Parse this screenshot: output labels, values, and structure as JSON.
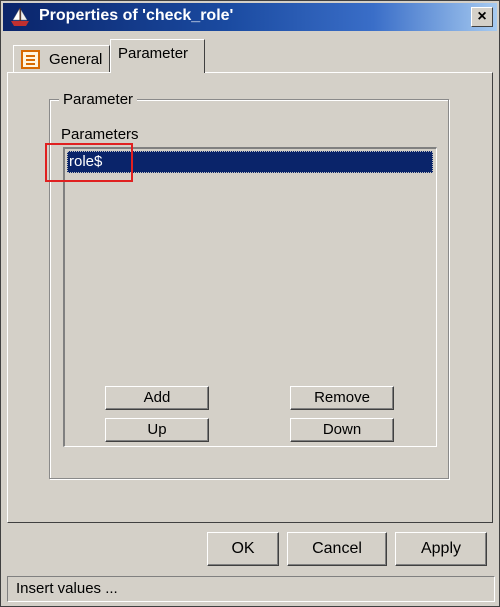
{
  "window": {
    "title": "Properties of 'check_role'",
    "close_label": "×",
    "app_icon": "ship-icon"
  },
  "tabs": [
    {
      "label": "General",
      "icon": "list-document-icon",
      "active": false
    },
    {
      "label": "Parameter",
      "active": true
    }
  ],
  "parameter_group": {
    "legend": "Parameter",
    "list_label": "Parameters",
    "items": [
      "role$"
    ],
    "selected_index": 0
  },
  "list_buttons": {
    "add": "Add",
    "remove": "Remove",
    "up": "Up",
    "down": "Down"
  },
  "dialog_buttons": {
    "ok": "OK",
    "cancel": "Cancel",
    "apply": "Apply"
  },
  "status_text": "Insert values ...",
  "colors": {
    "dialog_face": "#d4d0c8",
    "title_gradient_start": "#0a246a",
    "title_gradient_end": "#a6caf0",
    "selection": "#0a246a",
    "annotation_box": "#e02020",
    "tab_icon": "#d86a00"
  }
}
